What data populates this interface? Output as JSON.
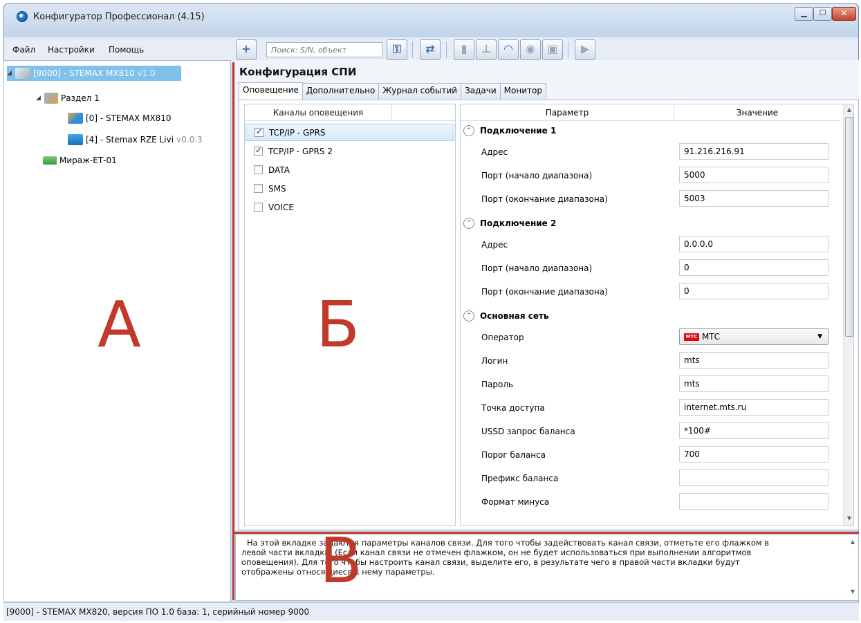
{
  "window": {
    "title": "Конфигуратор Профессионал (4.15)",
    "controls": {
      "minimize": "▁",
      "maximize": "☐",
      "close": "✕"
    }
  },
  "menu": [
    "Файл",
    "Настройки",
    "Помощь"
  ],
  "toolbar": {
    "search_placeholder": "Поиск: S/N, объект",
    "icons": [
      "add-icon",
      "key-icon",
      "users-icon",
      "usb-icon",
      "network-icon",
      "wifi-icon",
      "globe-icon",
      "server-icon",
      "play-icon"
    ],
    "glyphs": {
      "add": "+",
      "key": "⚿",
      "users": "⇄",
      "usb": "▮",
      "network": "⊥",
      "wifi": "◠",
      "globe": "◉",
      "server": "▣",
      "play": "▶"
    }
  },
  "tree": [
    {
      "label": "[9000] - STEMAX MX810",
      "version": "v1.0",
      "level": 0,
      "selected": true
    },
    {
      "label": "Раздел 1",
      "version": "",
      "level": 1,
      "selected": false
    },
    {
      "label": "[0] - STEMAX MX810",
      "version": "",
      "level": 2,
      "selected": false
    },
    {
      "label": "[4] - Stemax RZE Livi",
      "version": "v0.0.3",
      "level": 2,
      "selected": false
    },
    {
      "label": "Мираж-ЕТ-01",
      "version": "",
      "level": 1,
      "selected": false
    }
  ],
  "letters": {
    "a": "А",
    "b": "Б",
    "v": "В"
  },
  "config": {
    "title": "Конфигурация СПИ",
    "tabs": [
      "Оповещение",
      "Дополнительно",
      "Журнал событий",
      "Задачи",
      "Монитор"
    ],
    "active_tab": 0
  },
  "channels": {
    "header": "Каналы оповещения",
    "items": [
      {
        "label": "TCP/IP - GPRS",
        "checked": true,
        "selected": true
      },
      {
        "label": "TCP/IP - GPRS 2",
        "checked": true,
        "selected": false
      },
      {
        "label": "DATA",
        "checked": false,
        "selected": false
      },
      {
        "label": "SMS",
        "checked": false,
        "selected": false
      },
      {
        "label": "VOICE",
        "checked": false,
        "selected": false
      }
    ]
  },
  "params": {
    "col_param": "Параметр",
    "col_value": "Значение",
    "toggle_glyph": "⌃",
    "groups": [
      {
        "title": "Подключение 1",
        "rows": [
          {
            "name": "Адрес",
            "value": "91.216.216.91"
          },
          {
            "name": "Порт (начало диапазона)",
            "value": "5000"
          },
          {
            "name": "Порт (окончание диапазона)",
            "value": "5003"
          }
        ]
      },
      {
        "title": "Подключение 2",
        "rows": [
          {
            "name": "Адрес",
            "value": "0.0.0.0"
          },
          {
            "name": "Порт (начало диапазона)",
            "value": "0"
          },
          {
            "name": "Порт (окончание диапазона)",
            "value": "0"
          }
        ]
      },
      {
        "title": "Основная сеть",
        "rows": [
          {
            "name": "Оператор",
            "value": "МТС",
            "combo": true,
            "logo": "МТС"
          },
          {
            "name": "Логин",
            "value": "mts"
          },
          {
            "name": "Пароль",
            "value": "mts"
          },
          {
            "name": "Точка доступа",
            "value": "internet.mts.ru"
          },
          {
            "name": "USSD запрос баланса",
            "value": "*100#"
          },
          {
            "name": "Порог баланса",
            "value": "700"
          },
          {
            "name": "Префикс баланса",
            "value": ""
          },
          {
            "name": "Формат минуса",
            "value": ""
          }
        ]
      }
    ]
  },
  "help": {
    "lines": [
      "На этой вкладке задаются параметры каналов связи. Для того чтобы задействовать канал связи, отметьте его флажком в",
      "левой части вкладки. (Если канал связи не отмечен флажком, он не будет использоваться при выполнении алгоритмов",
      "оповещения). Для того чтобы настроить канал связи, выделите его, в результате чего в правой части вкладки будут",
      "отображены относящиеся к нему параметры."
    ]
  },
  "status": "[9000] - STEMAX MX820, версия ПО 1.0 база: 1, серийный номер 9000",
  "colors": {
    "accent_red": "#c33a2c",
    "selection": "#7fc1ea"
  }
}
